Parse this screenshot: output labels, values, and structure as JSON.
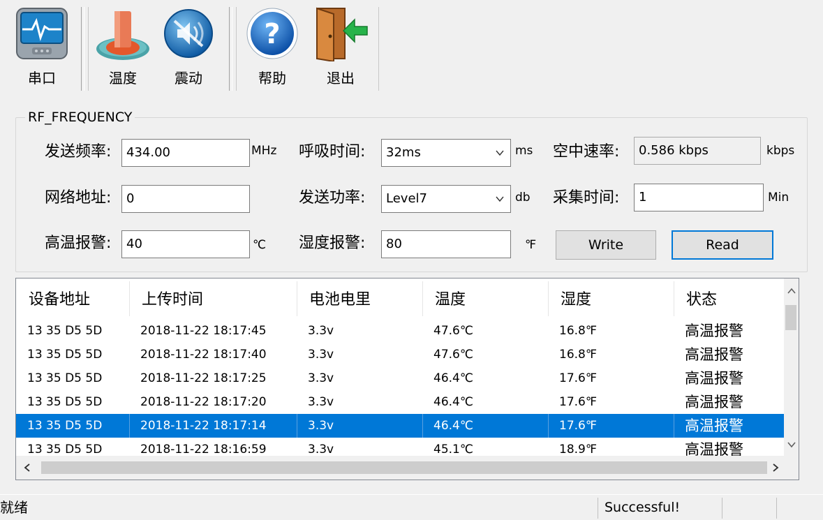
{
  "toolbar": {
    "serial_label": "串口",
    "temp_label": "温度",
    "vibration_label": "震动",
    "help_label": "帮助",
    "exit_label": "退出"
  },
  "rf": {
    "group_title": "RF_FREQUENCY",
    "send_freq_label": "发送频率:",
    "send_freq_value": "434.00",
    "send_freq_unit": "MHz",
    "breath_time_label": "呼吸时间:",
    "breath_time_value": "32ms",
    "breath_time_unit": "ms",
    "air_rate_label": "空中速率:",
    "air_rate_value": "0.586 kbps",
    "air_rate_unit": "kbps",
    "net_addr_label": "网络地址:",
    "net_addr_value": "0",
    "send_power_label": "发送功率:",
    "send_power_value": "Level7",
    "send_power_unit": "db",
    "collect_time_label": "采集时间:",
    "collect_time_value": "1",
    "collect_time_unit": "Min",
    "high_temp_label": "高温报警:",
    "high_temp_value": "40",
    "high_temp_unit": "℃",
    "humidity_label": "湿度报警:",
    "humidity_value": "80",
    "humidity_unit": "℉",
    "write_label": "Write",
    "read_label": "Read"
  },
  "table": {
    "columns": [
      "设备地址",
      "上传时间",
      "电池电里",
      "温度",
      "湿度",
      "状态"
    ],
    "rows": [
      [
        "13 35 D5 5D",
        "2018-11-22 18:17:45",
        "3.3v",
        "47.6℃",
        "16.8℉",
        "高温报警"
      ],
      [
        "13 35 D5 5D",
        "2018-11-22 18:17:40",
        "3.3v",
        "47.6℃",
        "16.8℉",
        "高温报警"
      ],
      [
        "13 35 D5 5D",
        "2018-11-22 18:17:25",
        "3.3v",
        "46.4℃",
        "17.6℉",
        "高温报警"
      ],
      [
        "13 35 D5 5D",
        "2018-11-22 18:17:20",
        "3.3v",
        "46.4℃",
        "17.6℉",
        "高温报警"
      ],
      [
        "13 35 D5 5D",
        "2018-11-22 18:17:14",
        "3.3v",
        "46.4℃",
        "17.6℉",
        "高温报警"
      ],
      [
        "13 35 D5 5D",
        "2018-11-22 18:16:59",
        "3.3v",
        "45.1℃",
        "18.9℉",
        "高温报警"
      ]
    ],
    "selected_row": 4
  },
  "status": {
    "left": "就绪",
    "right": "Successful!"
  },
  "colors": {
    "selection": "#0078d7",
    "window_bg": "#f0f0f0"
  },
  "icons": [
    "serial-port-icon",
    "temperature-icon",
    "vibration-icon",
    "help-icon",
    "exit-door-icon"
  ]
}
